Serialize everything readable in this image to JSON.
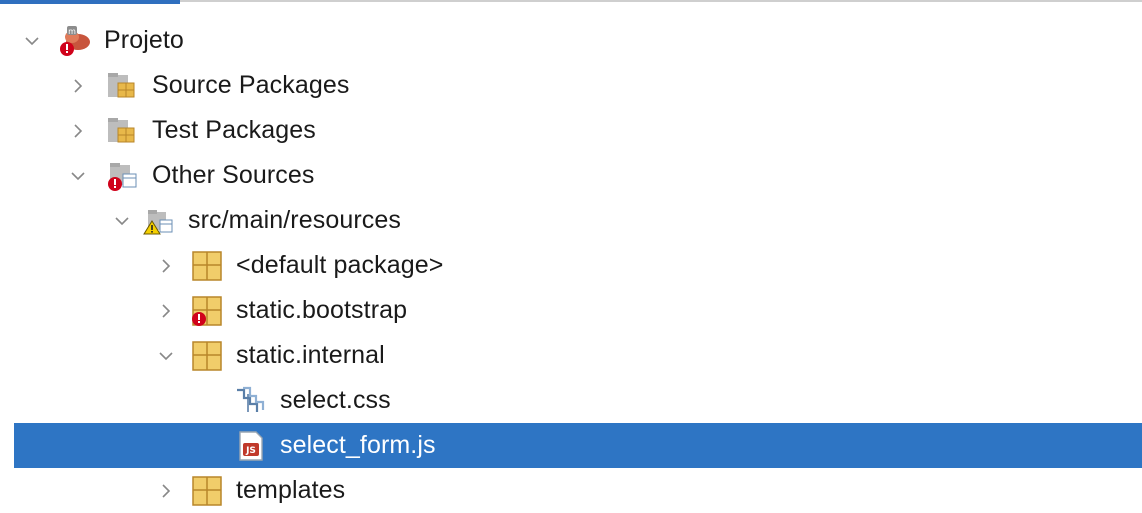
{
  "tree": {
    "nodes": [
      {
        "label": "Projeto",
        "expanded": true,
        "icon": "maven-project-error-icon"
      },
      {
        "label": "Source Packages",
        "expanded": false,
        "icon": "source-packages-icon"
      },
      {
        "label": "Test Packages",
        "expanded": false,
        "icon": "test-packages-icon"
      },
      {
        "label": "Other Sources",
        "expanded": true,
        "icon": "other-sources-error-icon"
      },
      {
        "label": "src/main/resources",
        "expanded": true,
        "icon": "resource-folder-warning-icon"
      },
      {
        "label": "<default package>",
        "expanded": false,
        "icon": "package-icon"
      },
      {
        "label": "static.bootstrap",
        "expanded": false,
        "icon": "package-error-icon"
      },
      {
        "label": "static.internal",
        "expanded": true,
        "icon": "package-icon"
      },
      {
        "label": "select.css",
        "icon": "css-file-icon"
      },
      {
        "label": "select_form.js",
        "icon": "js-file-icon",
        "selected": true
      },
      {
        "label": "templates",
        "expanded": false,
        "icon": "package-icon"
      }
    ]
  },
  "colors": {
    "selection": "#2e75c4",
    "accent": "#2f6fbf",
    "package": "#e8b84a",
    "error": "#d0021b"
  }
}
